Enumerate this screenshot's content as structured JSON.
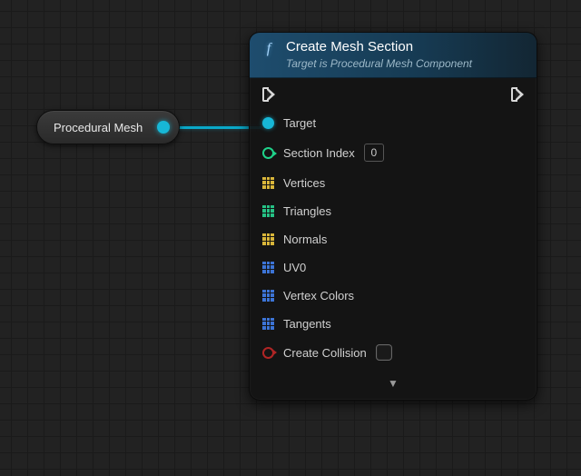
{
  "var_node": {
    "label": "Procedural Mesh"
  },
  "node": {
    "title": "Create Mesh Section",
    "subtitle": "Target is Procedural Mesh Component",
    "pins": {
      "target": "Target",
      "section_index": {
        "label": "Section Index",
        "value": "0"
      },
      "vertices": "Vertices",
      "triangles": "Triangles",
      "normals": "Normals",
      "uv0": "UV0",
      "vertex_colors": "Vertex Colors",
      "tangents": "Tangents",
      "create_collision": "Create Collision"
    },
    "expand_glyph": "▼"
  }
}
